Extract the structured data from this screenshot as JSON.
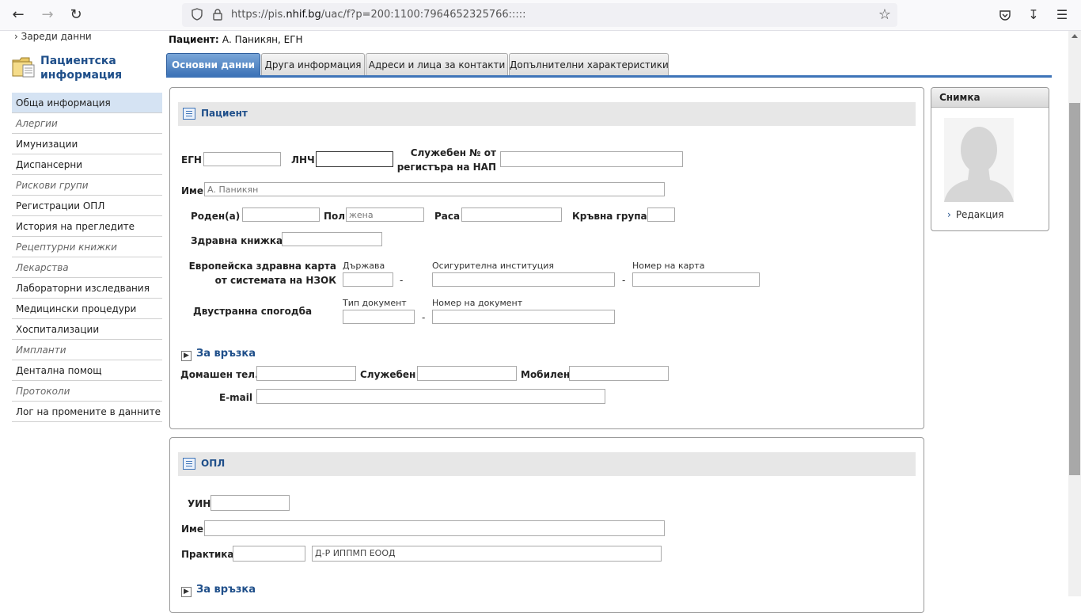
{
  "browser": {
    "url_prefix": "https://pis.",
    "url_host": "nhif.bg",
    "url_path": "/uac/f?p=200:1100:7964652325766:::::"
  },
  "leftnav": {
    "reload": "Зареди данни",
    "title_line1": "Пациентска",
    "title_line2": "информация",
    "items": [
      {
        "label": "Обща информация"
      },
      {
        "label": "Алергии"
      },
      {
        "label": "Имунизации"
      },
      {
        "label": "Диспансерни"
      },
      {
        "label": "Рискови групи"
      },
      {
        "label": "Регистрации ОПЛ"
      },
      {
        "label": "История на прегледите"
      },
      {
        "label": "Рецептурни книжки"
      },
      {
        "label": "Лекарства"
      },
      {
        "label": "Лабораторни изследвания"
      },
      {
        "label": "Медицински процедури"
      },
      {
        "label": "Хоспитализации"
      },
      {
        "label": "Импланти"
      },
      {
        "label": "Дентална помощ"
      },
      {
        "label": "Протоколи"
      },
      {
        "label": "Лог на промените в данните"
      }
    ]
  },
  "header": {
    "patient_label": "Пациент:",
    "patient_name": "А. Паникян, ЕГН"
  },
  "tabs": [
    "Основни данни",
    "Друга информация",
    "Адреси и лица за контакти",
    "Допълнителни характеристики"
  ],
  "patient": {
    "section_title": "Пациент",
    "egn_label": "ЕГН",
    "lnch_label": "ЛНЧ",
    "nap_label_1": "Служебен № от",
    "nap_label_2": "регистъра на НАП",
    "name_label": "Име",
    "name_value": "А. Паникян",
    "born_label": "Роден(а)",
    "sex_label": "Пол",
    "sex_value": "жена",
    "race_label": "Раса",
    "blood_label": "Кръвна група",
    "health_book_label": "Здравна книжка",
    "ehic_label_1": "Европейска здравна карта",
    "ehic_label_2": "от системата на НЗОК",
    "country_label": "Държава",
    "insurer_label": "Осигурителна институция",
    "card_no_label": "Номер на карта",
    "bilateral_label": "Двустранна спогодба",
    "doc_type_label": "Тип документ",
    "doc_no_label": "Номер на документ",
    "dash": "-",
    "contact_title": "За връзка",
    "home_tel_label": "Домашен тел.",
    "work_label": "Служебен",
    "mobile_label": "Мобилен",
    "email_label": "E-mail"
  },
  "opl": {
    "section_title": "ОПЛ",
    "uin_label": "УИН",
    "name_label": "Име",
    "practice_label": "Практика",
    "practice_name": "Д-Р ИППМП ЕООД",
    "contact_title": "За връзка"
  },
  "photo": {
    "title": "Снимка",
    "edit": "Редакция"
  }
}
